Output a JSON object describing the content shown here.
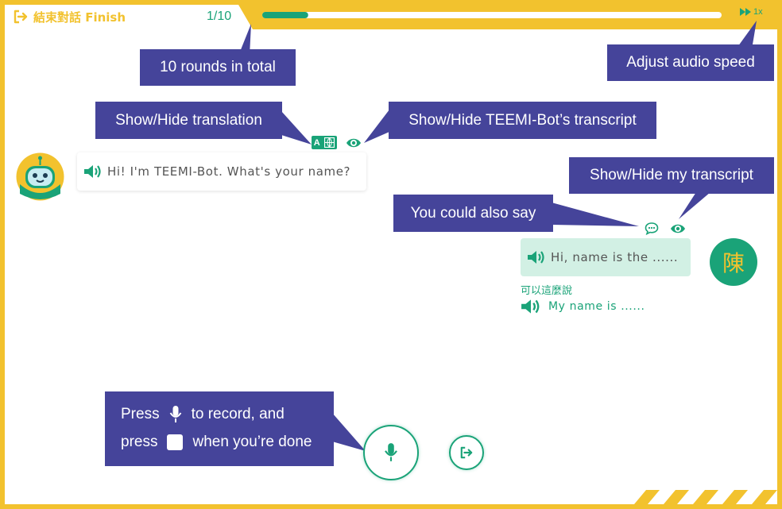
{
  "header": {
    "finish_label": "結束對話 Finish",
    "round_counter": "1/10",
    "progress_fraction": 0.1,
    "speed_label": "1x"
  },
  "tooltips": {
    "rounds": "10 rounds in total",
    "speed": "Adjust audio speed",
    "translation": "Show/Hide translation",
    "bot_transcript": "Show/Hide TEEMI-Bot’s transcript",
    "my_transcript": "Show/Hide my transcript",
    "also_say": "You could also say",
    "record_line1_pre": "Press",
    "record_line1_post": "to record, and",
    "record_line2_pre": "press",
    "record_line2_post": "when you’re done"
  },
  "bot_message": {
    "text": "Hi! I'm TEEMI-Bot. What's your name?"
  },
  "user_message": {
    "text": "Hi, name is the ......",
    "avatar_char": "陳"
  },
  "suggestion": {
    "label": "可以這麼說",
    "text": "My name is ......"
  },
  "colors": {
    "frame": "#f2c22e",
    "accent": "#1aa378",
    "tooltip": "#45449a",
    "user_bubble": "#d2f0e4"
  }
}
